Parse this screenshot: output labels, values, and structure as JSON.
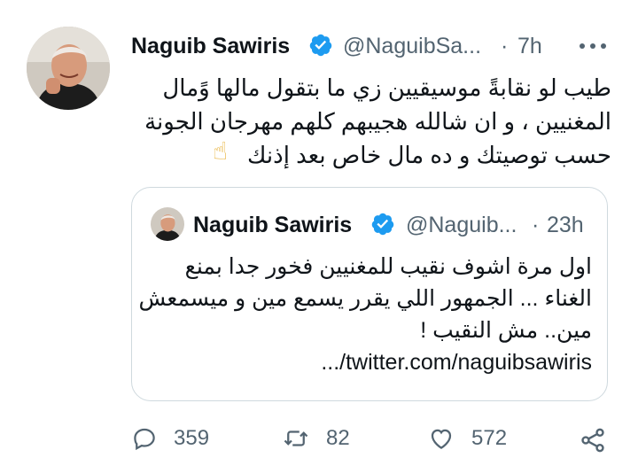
{
  "tweet": {
    "display_name": "Naguib Sawiris",
    "handle": "@NaguibSa...",
    "separator": "·",
    "time": "7h",
    "more_label": "···",
    "text_lines": [
      "طيب لو نقابةً موسيقيين زي ما بتقول مالها وًمال",
      "المغنيين ، و ان شالله هجيبهم كلهم مهرجان الجونة",
      "حسب توصيتك و ده مال خاص بعد إذنك"
    ],
    "emoji": "☝"
  },
  "quoted": {
    "display_name": "Naguib Sawiris",
    "handle": "@Naguib...",
    "separator": "·",
    "time": "23h",
    "text_lines": [
      "اول مرة اشوف نقيب للمغنيين فخور جدا بمنع",
      "الغناء ... الجمهور اللي يقرر يسمع مين و ميسمعش",
      "مين.. مش النقيب !"
    ],
    "link": ".../twitter.com/naguibsawiris"
  },
  "actions": {
    "replies": "359",
    "retweets": "82",
    "likes": "572"
  },
  "colors": {
    "verified_blue": "#1d9bf0",
    "muted": "#536471",
    "border": "#cfd9de"
  },
  "icons": [
    "verified-badge-icon",
    "more-icon",
    "reply-icon",
    "retweet-icon",
    "like-icon",
    "share-icon"
  ]
}
